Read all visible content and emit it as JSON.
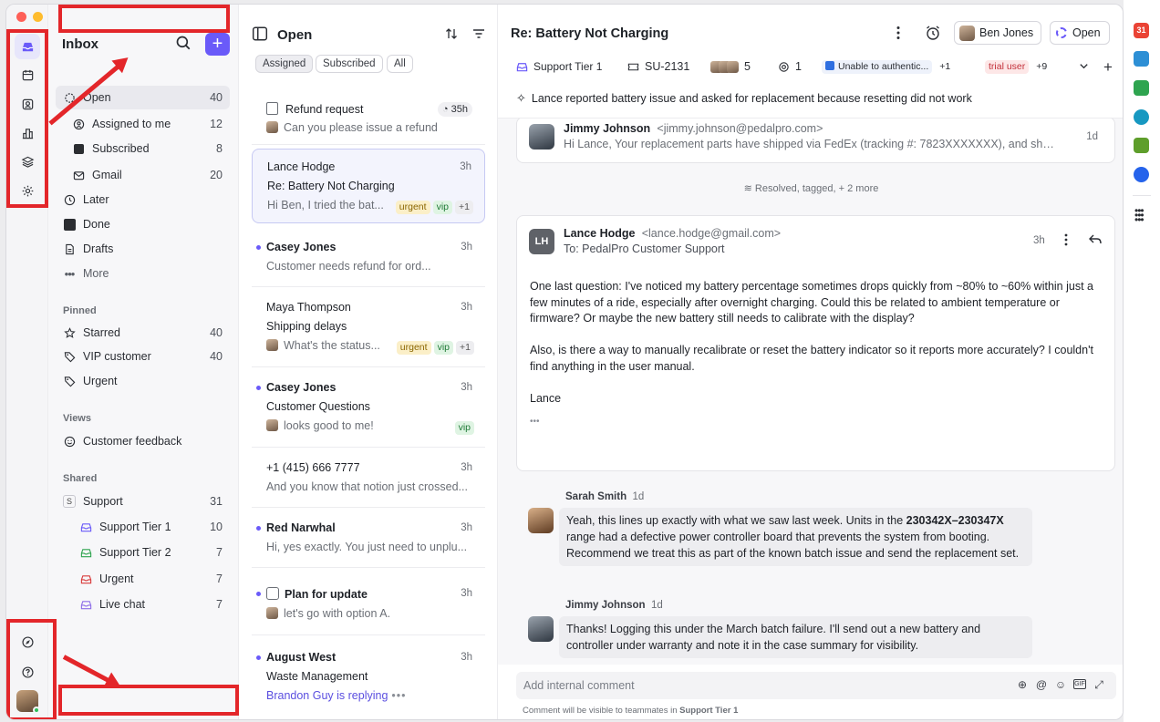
{
  "sidebar": {
    "title": "Inbox",
    "compose": "+",
    "items": [
      {
        "label": "Open",
        "count": "40"
      },
      {
        "label": "Assigned to me",
        "count": "12"
      },
      {
        "label": "Subscribed",
        "count": "8"
      },
      {
        "label": "Gmail",
        "count": "20"
      },
      {
        "label": "Later",
        "count": ""
      },
      {
        "label": "Done",
        "count": ""
      },
      {
        "label": "Drafts",
        "count": ""
      },
      {
        "label": "More",
        "count": ""
      }
    ],
    "pinned_title": "Pinned",
    "pinned": [
      {
        "label": "Starred",
        "count": "40"
      },
      {
        "label": "VIP customer",
        "count": "40"
      },
      {
        "label": "Urgent",
        "count": ""
      }
    ],
    "views_title": "Views",
    "views": [
      {
        "label": "Customer feedback"
      }
    ],
    "shared_title": "Shared",
    "shared": [
      {
        "label": "Support",
        "count": "31",
        "badge": "S"
      },
      {
        "label": "Support Tier 1",
        "count": "10",
        "color": "#6a5af9"
      },
      {
        "label": "Support Tier 2",
        "count": "7",
        "color": "#2ea44f"
      },
      {
        "label": "Urgent",
        "count": "7",
        "color": "#d83a3a"
      },
      {
        "label": "Live chat",
        "count": "7",
        "color": "#8e6ee8"
      }
    ]
  },
  "list": {
    "title": "Open",
    "tabs": [
      "Assigned",
      "Subscribed",
      "All"
    ],
    "conversations": [
      {
        "name": "Refund request",
        "time": "35h",
        "preview": "Can you please issue a refund"
      },
      {
        "name": "Lance Hodge",
        "time": "3h",
        "subject": "Re: Battery Not Charging",
        "preview": "Hi Ben, I tried the bat...",
        "tags": [
          "urgent",
          "vip",
          "+1"
        ]
      },
      {
        "name": "Casey Jones",
        "time": "3h",
        "preview": "Customer needs refund for ord..."
      },
      {
        "name": "Maya Thompson",
        "time": "3h",
        "subject": "Shipping delays",
        "preview": "What's the status...",
        "tags": [
          "urgent",
          "vip",
          "+1"
        ]
      },
      {
        "name": "Casey Jones",
        "time": "3h",
        "subject": "Customer Questions",
        "preview": "looks good to me!",
        "tags": [
          "vip"
        ]
      },
      {
        "name": "+1 (415) 666 7777",
        "time": "3h",
        "preview": "And you know that notion just crossed..."
      },
      {
        "name": "Red Narwhal",
        "time": "3h",
        "preview": "Hi, yes exactly. You just need to unplu..."
      },
      {
        "name": "Plan for update",
        "time": "3h",
        "preview": "let's go with option A."
      },
      {
        "name": "August West",
        "time": "3h",
        "subject": "Waste Management",
        "preview": "Brandon Guy is replying"
      }
    ]
  },
  "main": {
    "title": "Re: Battery Not Charging",
    "assignee": "Ben Jones",
    "status": "Open",
    "meta": {
      "inbox": "Support Tier 1",
      "ticket": "SU-2131",
      "participants": "5",
      "count": "1",
      "link": "Unable to authentic...",
      "link_more": "+1",
      "tag": "trial user",
      "tag_more": "+9"
    },
    "summary": "Lance reported battery issue and asked for replacement because resetting did not work",
    "messages": {
      "first": {
        "name": "Jimmy Johnson",
        "email": "<jimmy.johnson@pedalpro.com>",
        "time": "1d",
        "preview": "Hi Lance, Your replacement parts have shipped via FedEx (tracking #: 7823XXXXXXX), and shoul..."
      },
      "activity": "Resolved, tagged, + 2 more",
      "second": {
        "initials": "LH",
        "name": "Lance Hodge",
        "email": "<lance.hodge@gmail.com>",
        "to": "To: PedalPro Customer Support",
        "time": "3h",
        "p1": "One last question: I've noticed my battery percentage sometimes drops quickly from ~80% to ~60% within just a few minutes of a ride, especially after overnight charging. Could this be related to ambient temperature or firmware? Or maybe the new battery still needs to calibrate with the display?",
        "p2": "Also, is there a way to manually recalibrate or reset the battery indicator so it reports more accurately? I couldn't find anything in the user manual.",
        "sig": "Lance",
        "ellipsis": "•••"
      }
    },
    "comments": [
      {
        "name": "Sarah Smith",
        "time": "1d",
        "pre": "Yeah, this lines up exactly with what we saw last week. Units in the ",
        "bold": "230342X–230347X",
        "post": " range had a defective power controller board that prevents the system from booting. Recommend we treat this as part of the known batch issue and send the replacement set."
      },
      {
        "name": "Jimmy Johnson",
        "time": "1d",
        "text": "Thanks! Logging this under the March batch failure. I'll send out a new battery and controller under warranty and note it in the case summary for visibility."
      }
    ],
    "composer": {
      "placeholder": "Add internal comment",
      "hint_pre": "Comment will be visible to teammates in ",
      "hint_team": "Support Tier 1"
    }
  },
  "apps": {
    "calendar_day": "31"
  }
}
